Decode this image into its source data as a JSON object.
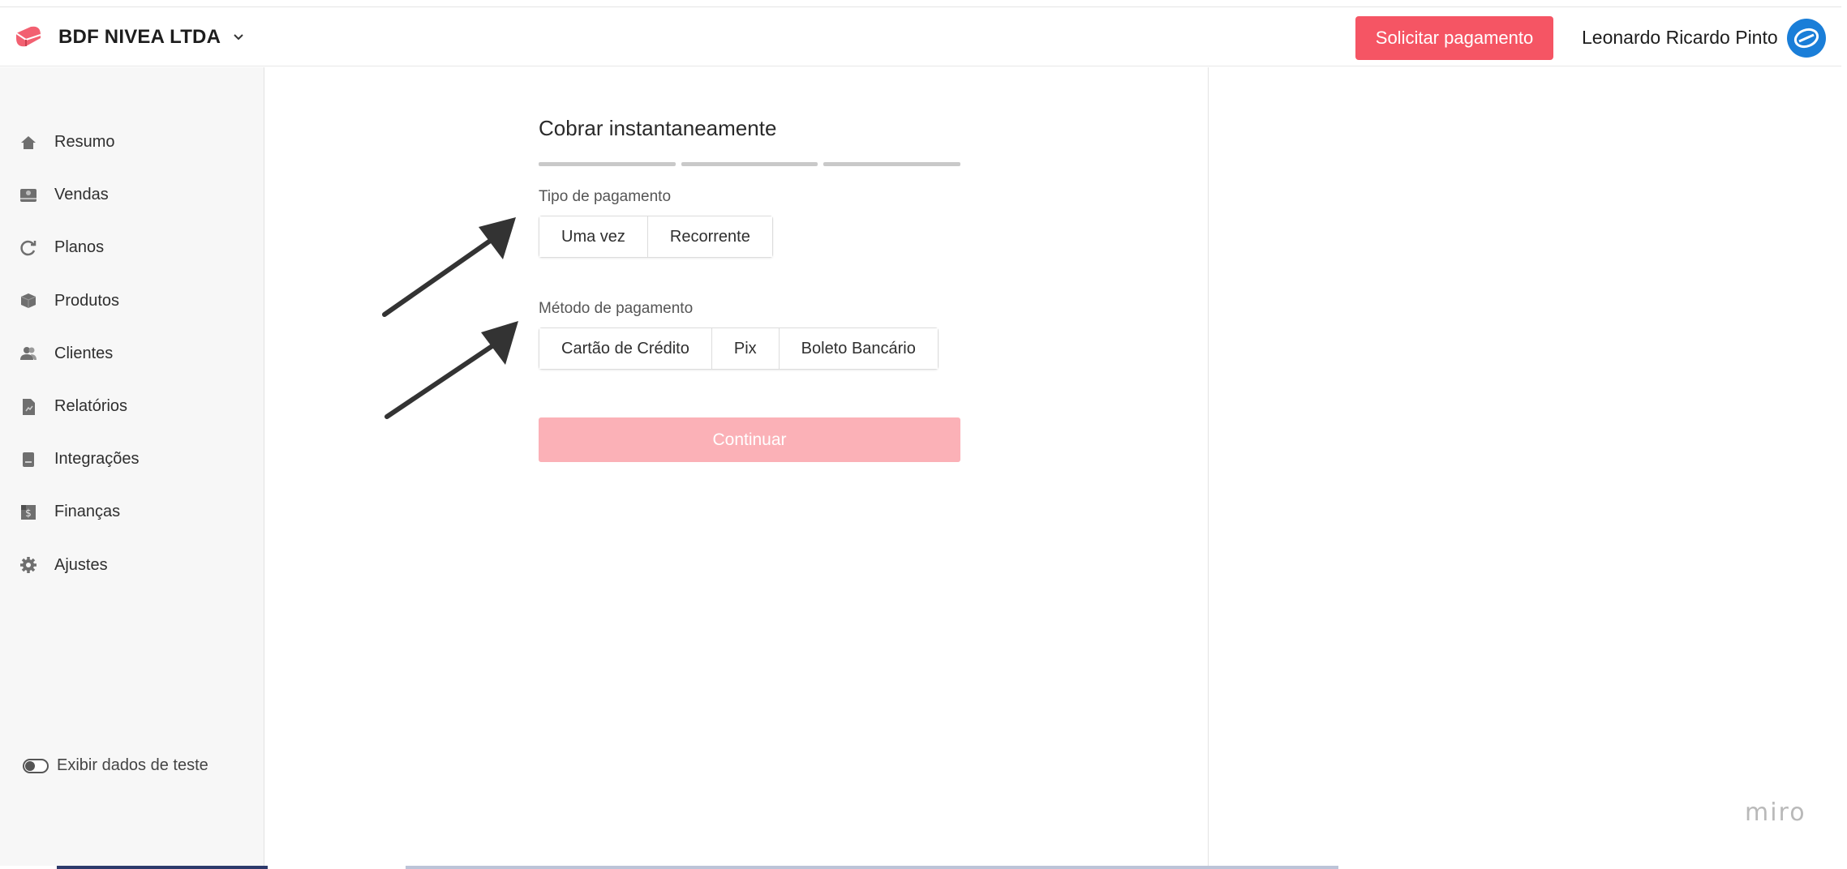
{
  "header": {
    "company_name": "BDF NIVEA LTDA",
    "cta_label": "Solicitar pagamento",
    "user_name": "Leonardo Ricardo Pinto"
  },
  "sidebar": {
    "items": [
      {
        "label": "Resumo",
        "icon": "home-icon"
      },
      {
        "label": "Vendas",
        "icon": "sales-icon"
      },
      {
        "label": "Planos",
        "icon": "refresh-icon"
      },
      {
        "label": "Produtos",
        "icon": "box-icon"
      },
      {
        "label": "Clientes",
        "icon": "users-icon"
      },
      {
        "label": "Relatórios",
        "icon": "report-icon"
      },
      {
        "label": "Integrações",
        "icon": "integration-icon"
      },
      {
        "label": "Finanças",
        "icon": "finance-icon"
      },
      {
        "label": "Ajustes",
        "icon": "gear-icon"
      }
    ],
    "test_toggle_label": "Exibir dados de teste"
  },
  "form": {
    "title": "Cobrar instantaneamente",
    "payment_type_label": "Tipo de pagamento",
    "payment_type_options": [
      "Uma vez",
      "Recorrente"
    ],
    "payment_method_label": "Método de pagamento",
    "payment_method_options": [
      "Cartão de Crédito",
      "Pix",
      "Boleto Bancário"
    ],
    "continue_label": "Continuar"
  },
  "watermark": "miro",
  "colors": {
    "accent": "#f55564",
    "accent_disabled": "#fbb1b7",
    "avatar": "#1a7ed8"
  }
}
